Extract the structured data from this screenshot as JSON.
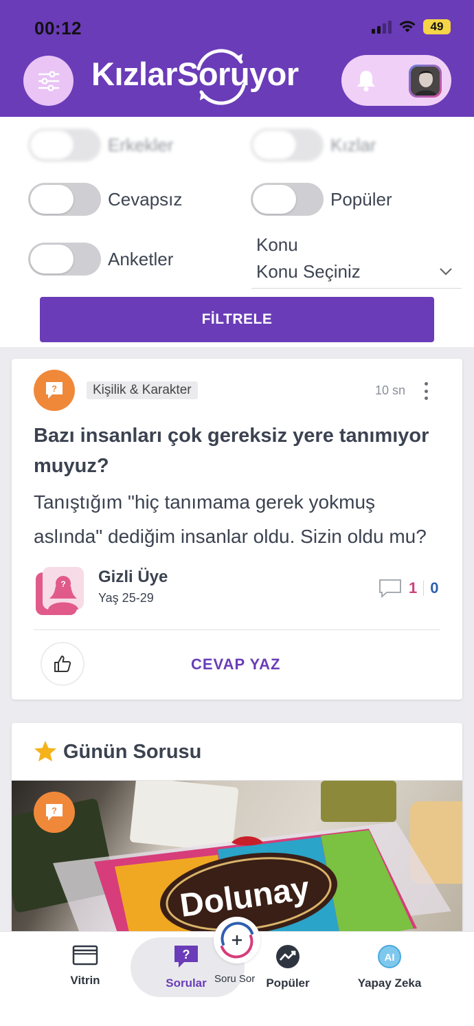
{
  "status_bar": {
    "time": "00:12",
    "battery": "49"
  },
  "header": {
    "logo_text": "KızlarSoruyor"
  },
  "filters": {
    "toggles": [
      {
        "label": "Erkekler"
      },
      {
        "label": "Kızlar"
      },
      {
        "label": "Cevapsız"
      },
      {
        "label": "Popüler"
      },
      {
        "label": "Anketler"
      }
    ],
    "topic_label": "Konu",
    "topic_value": "Konu Seçiniz",
    "submit_label": "FİLTRELE"
  },
  "question": {
    "category": "Kişilik & Karakter",
    "time": "10 sn",
    "title": "Bazı insanları çok gereksiz yere tanımıyor muyuz?",
    "body": "Tanıştığım \"hiç tanımama gerek yokmuş aslında\" dediğim insanlar oldu. Sizin oldu mu?",
    "author_name": "Gizli Üye",
    "author_age": "Yaş 25-29",
    "answer_count": "1",
    "like_count": "0",
    "answer_button": "CEVAP YAZ"
  },
  "question_of_day": {
    "title": "Günün Sorusu",
    "image_brand_text": "Dolunay"
  },
  "bottom_nav": {
    "items": [
      {
        "label": "Vitrin",
        "icon": "showcase-icon"
      },
      {
        "label": "Sorular",
        "icon": "question-icon"
      },
      {
        "label": "Soru Sor",
        "icon": "add-question-icon"
      },
      {
        "label": "Popüler",
        "icon": "trending-icon"
      },
      {
        "label": "Yapay Zeka",
        "icon": "ai-icon"
      }
    ]
  },
  "colors": {
    "brand": "#6a3cb8",
    "accent_orange": "#f0883a",
    "pink": "#c9437a",
    "blue": "#2f5fb0"
  }
}
